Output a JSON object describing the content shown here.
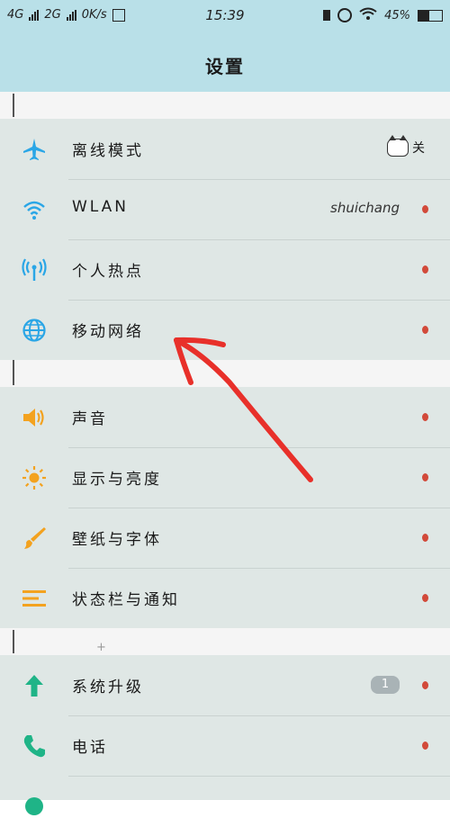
{
  "status_bar": {
    "left": [
      "4G",
      "2G",
      "0K/s"
    ],
    "time": "15:39",
    "battery": "45%"
  },
  "header": {
    "title": "设置"
  },
  "groups": [
    {
      "items": [
        {
          "label": "离线模式",
          "icon": "airplane-icon",
          "toggle": "关"
        },
        {
          "label": "WLAN",
          "icon": "wifi-icon",
          "value": "shuichang"
        },
        {
          "label": "个人热点",
          "icon": "hotspot-icon"
        },
        {
          "label": "移动网络",
          "icon": "globe-icon"
        }
      ]
    },
    {
      "items": [
        {
          "label": "声音",
          "icon": "speaker-icon"
        },
        {
          "label": "显示与亮度",
          "icon": "brightness-icon"
        },
        {
          "label": "壁纸与字体",
          "icon": "brush-icon"
        },
        {
          "label": "状态栏与通知",
          "icon": "list-icon"
        }
      ]
    },
    {
      "items": [
        {
          "label": "系统升级",
          "icon": "arrow-up-icon",
          "badge": "1"
        },
        {
          "label": "电话",
          "icon": "phone-icon"
        }
      ]
    }
  ],
  "colors": {
    "header_bg": "#b9e0e8",
    "row_bg": "#dfe7e5",
    "blue_icon": "#2aa6e6",
    "orange_icon": "#f3a21f",
    "green_icon": "#1fb487",
    "dot": "#d24a3a",
    "annotation": "#e8302a"
  }
}
